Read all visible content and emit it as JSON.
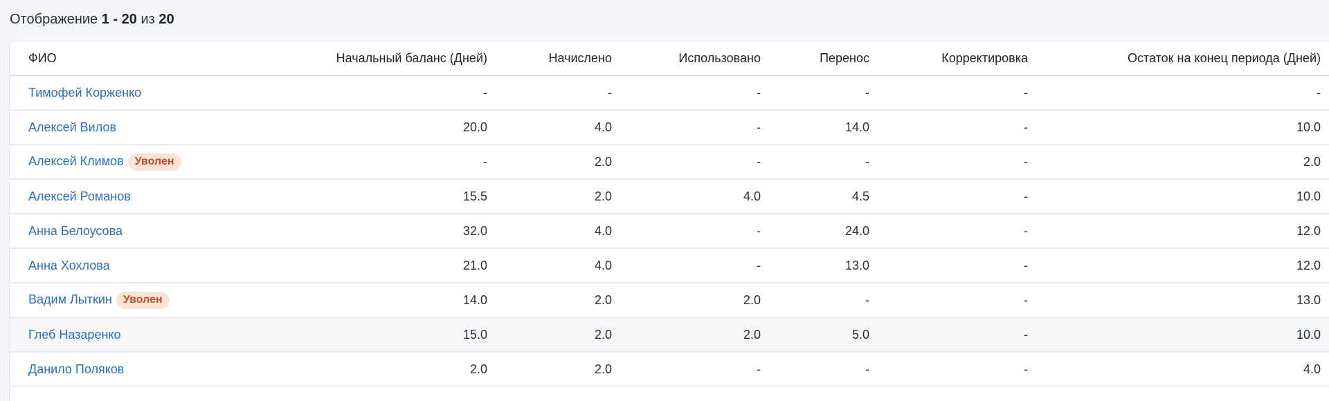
{
  "summary": {
    "prefix": "Отображение",
    "range": "1 - 20",
    "of_label": "из",
    "total": "20"
  },
  "table": {
    "headers": {
      "name": "ФИО",
      "opening_balance": "Начальный баланс (Дней)",
      "accrued": "Начислено",
      "used": "Использовано",
      "transfer": "Перенос",
      "correction": "Корректировка",
      "closing_balance": "Остаток на конец периода (Дней)"
    },
    "rows": [
      {
        "name": "Тимофей Корженко",
        "badge": "",
        "opening": "-",
        "accrued": "-",
        "used": "-",
        "transfer": "-",
        "correction": "-",
        "closing": "-"
      },
      {
        "name": "Алексей Вилов",
        "badge": "",
        "opening": "20.0",
        "accrued": "4.0",
        "used": "-",
        "transfer": "14.0",
        "correction": "-",
        "closing": "10.0"
      },
      {
        "name": "Алексей Климов",
        "badge": "Уволен",
        "opening": "-",
        "accrued": "2.0",
        "used": "-",
        "transfer": "-",
        "correction": "-",
        "closing": "2.0"
      },
      {
        "name": "Алексей Романов",
        "badge": "",
        "opening": "15.5",
        "accrued": "2.0",
        "used": "4.0",
        "transfer": "4.5",
        "correction": "-",
        "closing": "10.0"
      },
      {
        "name": "Анна Белоусова",
        "badge": "",
        "opening": "32.0",
        "accrued": "4.0",
        "used": "-",
        "transfer": "24.0",
        "correction": "-",
        "closing": "12.0"
      },
      {
        "name": "Анна Хохлова",
        "badge": "",
        "opening": "21.0",
        "accrued": "4.0",
        "used": "-",
        "transfer": "13.0",
        "correction": "-",
        "closing": "12.0"
      },
      {
        "name": "Вадим Лыткин",
        "badge": "Уволен",
        "opening": "14.0",
        "accrued": "2.0",
        "used": "2.0",
        "transfer": "-",
        "correction": "-",
        "closing": "13.0"
      },
      {
        "name": "Глеб Назаренко",
        "badge": "",
        "opening": "15.0",
        "accrued": "2.0",
        "used": "2.0",
        "transfer": "5.0",
        "correction": "-",
        "closing": "10.0",
        "highlighted": true
      },
      {
        "name": "Данило Поляков",
        "badge": "",
        "opening": "2.0",
        "accrued": "2.0",
        "used": "-",
        "transfer": "-",
        "correction": "-",
        "closing": "4.0"
      }
    ]
  },
  "colors": {
    "link": "#2f6fb5",
    "badge_bg": "#fbe3d6",
    "badge_text": "#b8512a",
    "page_bg": "#f3f5fb"
  }
}
